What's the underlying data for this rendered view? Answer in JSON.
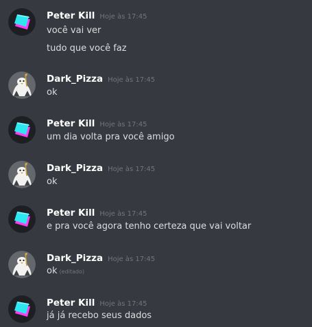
{
  "messages": [
    {
      "author": "Peter Kill",
      "avatar_icon": "cube-avatar-icon",
      "timestamp": "Hoje às 17:45",
      "lines": [
        "você vai ver",
        "tudo que você faz"
      ]
    },
    {
      "author": "Dark_Pizza",
      "avatar_icon": "penguin-avatar-icon",
      "timestamp": "Hoje às 17:45",
      "lines": [
        "ok"
      ]
    },
    {
      "author": "Peter Kill",
      "avatar_icon": "cube-avatar-icon",
      "timestamp": "Hoje às 17:45",
      "lines": [
        "um dia volta pra você amigo"
      ]
    },
    {
      "author": "Dark_Pizza",
      "avatar_icon": "penguin-avatar-icon",
      "timestamp": "Hoje às 17:45",
      "lines": [
        "ok"
      ]
    },
    {
      "author": "Peter Kill",
      "avatar_icon": "cube-avatar-icon",
      "timestamp": "Hoje às 17:45",
      "lines": [
        "e pra você agora tenho certeza que vai voltar"
      ]
    },
    {
      "author": "Dark_Pizza",
      "avatar_icon": "penguin-avatar-icon",
      "timestamp": "Hoje às 17:45",
      "lines": [
        "ok"
      ],
      "edited_label": "(editado)"
    },
    {
      "author": "Peter Kill",
      "avatar_icon": "cube-avatar-icon",
      "timestamp": "Hoje às 17:45",
      "lines": [
        "já já recebo seus dados"
      ]
    }
  ],
  "colors": {
    "background": "#36393f",
    "username": "#ffffff",
    "message_text": "#dcddde",
    "timestamp": "#72767d",
    "cube_cyan": "#2ee6f0",
    "cube_magenta": "#ff3cf0"
  }
}
